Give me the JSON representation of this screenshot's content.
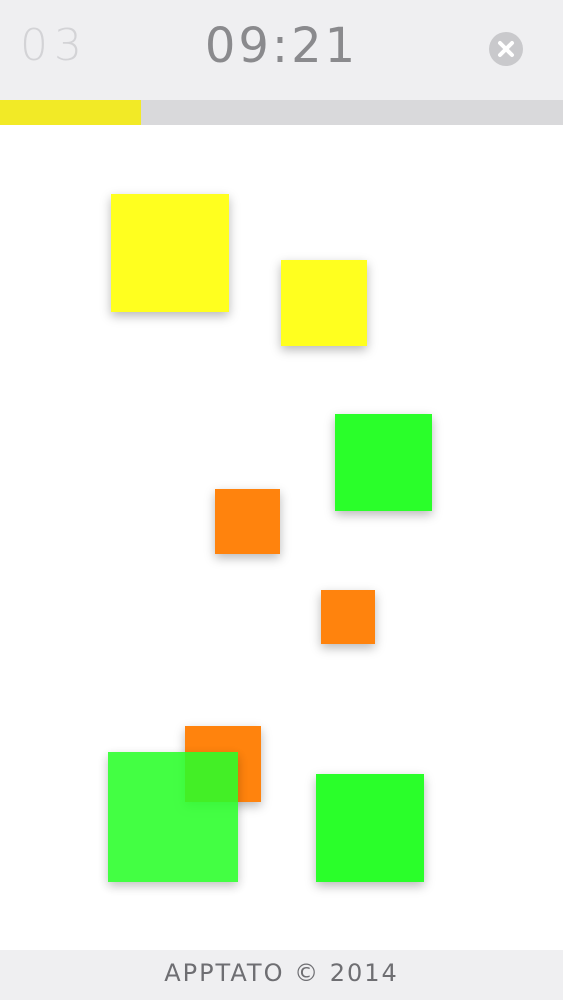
{
  "header": {
    "level": "03",
    "timer": "09:21",
    "close_icon": "close-icon"
  },
  "progress": {
    "fraction": 0.25,
    "color": "#f2ea26",
    "track_color": "#d9d9db"
  },
  "colors": {
    "yellow": "#ffff1f",
    "green": "#2aff2a",
    "orange": "#ff830d"
  },
  "tiles": [
    {
      "color": "yellow"
    },
    {
      "color": "yellow"
    },
    {
      "color": "green"
    },
    {
      "color": "orange"
    },
    {
      "color": "orange"
    },
    {
      "color": "orange"
    },
    {
      "color": "green"
    },
    {
      "color": "green"
    }
  ],
  "footer": {
    "copyright": "APPTATO © 2014"
  }
}
